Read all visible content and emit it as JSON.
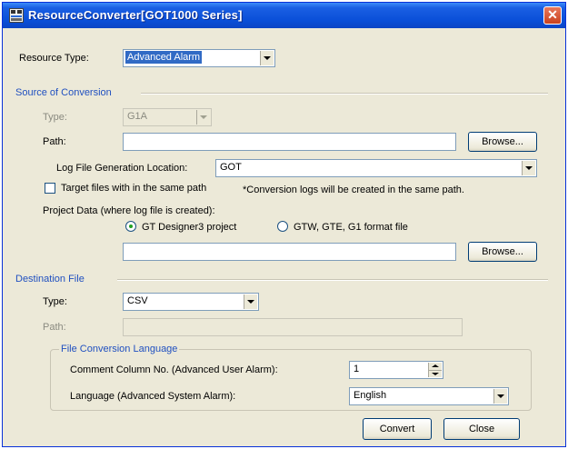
{
  "window": {
    "title": "ResourceConverter[GOT1000 Series]"
  },
  "resource_type": {
    "label": "Resource Type:",
    "value": "Advanced Alarm"
  },
  "source": {
    "group_label": "Source of Conversion",
    "type_label": "Type:",
    "type_value": "G1A",
    "path_label": "Path:",
    "path_value": "",
    "browse_label": "Browse...",
    "log_location_label": "Log File Generation Location:",
    "log_location_value": "GOT",
    "target_files_label": "Target files with in the same path",
    "conversion_note": "*Conversion logs will be created in the same path.",
    "project_data_label": "Project Data (where log file is created):",
    "radio_gt3_label": "GT Designer3 project",
    "radio_gtw_label": "GTW, GTE, G1 format file",
    "project_path_value": "",
    "browse2_label": "Browse..."
  },
  "destination": {
    "group_label": "Destination File",
    "type_label": "Type:",
    "type_value": "CSV",
    "path_label": "Path:",
    "path_value": ""
  },
  "language_group": {
    "legend": "File Conversion Language",
    "comment_label": "Comment Column No. (Advanced User Alarm):",
    "comment_value": "1",
    "language_label": "Language (Advanced System Alarm):",
    "language_value": "English"
  },
  "buttons": {
    "convert": "Convert",
    "close": "Close"
  },
  "colors": {
    "title_bar": "#0a4fd8",
    "group_label": "#2050c0",
    "selection": "#316ac5"
  },
  "icons": {
    "app": "app-icon",
    "close": "close-icon"
  }
}
